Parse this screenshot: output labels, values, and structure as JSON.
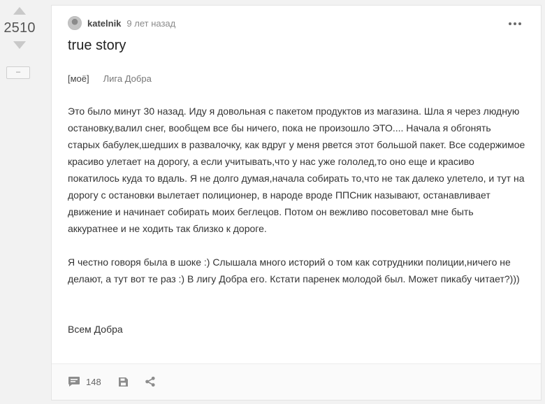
{
  "rating": {
    "score": "2510",
    "collapse_label": "–"
  },
  "post": {
    "author": "katelnik",
    "time": "9 лет назад",
    "title": "true story",
    "tags": [
      "[моё]",
      "Лига Добра"
    ],
    "paragraphs": [
      "Это было минут 30 назад. Иду я довольная с пакетом продуктов из магазина. Шла я через людную остановку,валил снег, вообщем все бы ничего, пока не произошло ЭТО.... Начала я обгонять старых бабулек,шедших в развалочку, как вдруг у меня рвется этот большой пакет. Все содержимое красиво улетает на дорогу, а если учитывать,что у нас уже гололед,то оно еще и красиво покатилось куда то вдаль. Я не долго думая,начала собирать то,что не так далеко улетело, и тут на дорогу с остановки вылетает полиционер, в народе вроде ППСник называют, останавливает движение и начинает собирать моих беглецов. Потом он вежливо посоветовал мне быть аккуратнее и не ходить так близко к дороге.",
      "Я честно говоря была в шоке :) Слышала много историй о том как сотрудники полиции,ничего не делают, а тут вот те раз :) В лигу Добра его. Кстати паренек молодой был. Может пикабу читает?)))",
      "Всем Добра"
    ],
    "comments_count": "148"
  },
  "icons": {
    "vote_up": "triangle-up-icon",
    "vote_down": "triangle-down-icon",
    "menu": "more-dots-icon",
    "comments": "comment-icon",
    "save": "save-icon",
    "share": "share-icon"
  },
  "colors": {
    "icon_gray": "#8c8c8c",
    "background": "#f2f2f2",
    "card": "#ffffff"
  }
}
